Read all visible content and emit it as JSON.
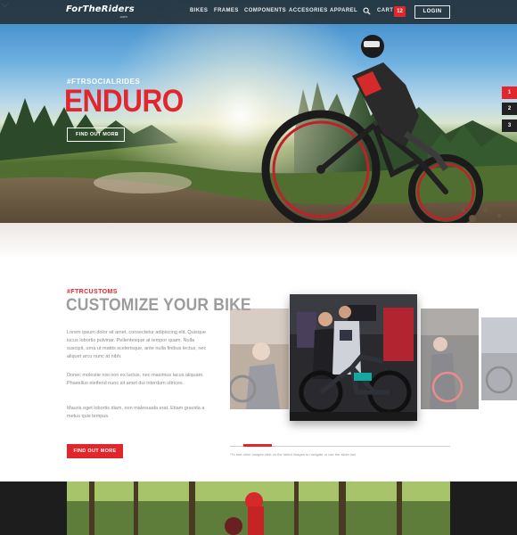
{
  "header": {
    "logo_text": "ForTheRiders",
    "logo_sub": ".com",
    "nav": [
      "BIKES",
      "FRAMES",
      "COMPONENTS",
      "ACCESORIES",
      "APPAREL"
    ],
    "cart_label": "CART",
    "cart_count": "12",
    "login_label": "LOGIN"
  },
  "hero": {
    "tag": "#FTRSOCIALRIDES",
    "title": "ENDURO",
    "button_label": "FIND OUT MORE",
    "pager": [
      "1",
      "2",
      "3"
    ],
    "active_page": 1
  },
  "customize": {
    "tag": "#FTRCUSTOMS",
    "title": "CUSTOMIZE YOUR BIKE",
    "paragraphs": [
      "Lorem ipsum dolor sit amet, consectetur adipiscing elit. Quisque iucus lobortis pulvinar. Pellentesque at tempor quam. Nulla suscipit, urna ut mattis scelerisque, ante nulla finibus lectus, nec aliquet arcu nunc at nibh.",
      "Donec molestie nisi non ex luctus, nec maximus lacus aliquam. Phasellus eleifend nunc sit amet dui interdum ultrices.",
      "Mauris eget lobortis diam, non malesuada erat. Etiam gravida a metus quis tempus."
    ],
    "button_label": "FIND OUT MORE",
    "slider_note": "*To see other images click on the faded images to navigate or use the slider bar"
  },
  "colors": {
    "accent": "#e3262b",
    "header_bg": "#26343c",
    "title_gray": "#9c9c9c"
  }
}
